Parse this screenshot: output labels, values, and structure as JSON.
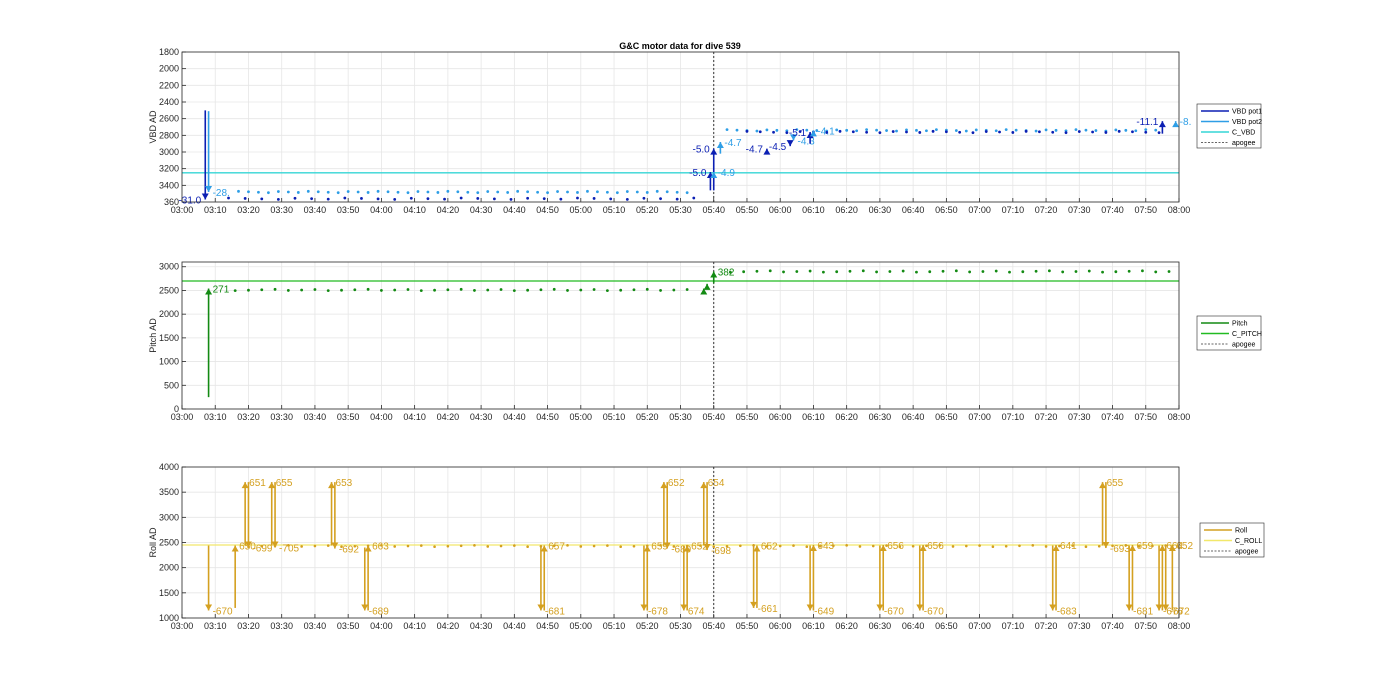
{
  "title": "G&C motor data for dive 539",
  "colors": {
    "vbd_pot1": "#0b1fb3",
    "vbd_pot2": "#2e9ee6",
    "c_vbd": "#35d6d6",
    "pitch": "#138a13",
    "c_pitch": "#22bb22",
    "roll": "#d4a020",
    "c_roll": "#f2e86a",
    "apogee": "#333333",
    "grid": "#e6e6e6"
  },
  "x_tick_labels": [
    "03:00",
    "03:10",
    "03:20",
    "03:30",
    "03:40",
    "03:50",
    "04:00",
    "04:10",
    "04:20",
    "04:30",
    "04:40",
    "04:50",
    "05:00",
    "05:10",
    "05:20",
    "05:30",
    "05:40",
    "05:50",
    "06:00",
    "06:10",
    "06:20",
    "06:30",
    "06:40",
    "06:50",
    "07:00",
    "07:10",
    "07:20",
    "07:30",
    "07:40",
    "07:50",
    "08:00"
  ],
  "chart_data": [
    {
      "type": "scatter",
      "title": "G&C motor data for dive 539",
      "ylabel": "VBD AD",
      "xlim": [
        "03:00",
        "08:00"
      ],
      "ylim": [
        1800,
        3600
      ],
      "y_reversed": true,
      "yticks": [
        1800,
        2000,
        2200,
        2400,
        2600,
        2800,
        3000,
        3200,
        3400,
        3600
      ],
      "y_tick_labels": [
        "1800",
        "2000",
        "2200",
        "2400",
        "2600",
        "2800",
        "3000",
        "3200",
        "3400",
        "360"
      ],
      "grid": true,
      "legend_position": "right",
      "legend": [
        "VBD pot1",
        "VBD pot2",
        "C_VBD",
        "apogee"
      ],
      "c_vbd": 3250,
      "apogee_x": "05:40",
      "pot1_base": [
        {
          "start": "03:14",
          "end": "05:34",
          "step": 5,
          "y": 3560
        },
        {
          "start": "05:50",
          "end": "07:55",
          "step": 4,
          "y": 2760
        }
      ],
      "pot2_base": [
        {
          "start": "03:17",
          "end": "05:34",
          "step": 3,
          "y": 3480
        },
        {
          "start": "05:44",
          "end": "07:55",
          "step": 3,
          "y": 2740
        }
      ],
      "moves": [
        {
          "t": "03:07",
          "from": 2500,
          "to": 3570,
          "series": "VBD pot1",
          "label": "-31.0",
          "label_side": "left"
        },
        {
          "t": "03:08",
          "from": 2510,
          "to": 3480,
          "series": "VBD pot2",
          "label": "-28.",
          "label_side": "right"
        },
        {
          "t": "05:39",
          "from": 3460,
          "to": 3240,
          "series": "VBD pot1",
          "label": "-5.0",
          "label_side": "left"
        },
        {
          "t": "05:40",
          "from": 3460,
          "to": 2960,
          "series": "VBD pot1",
          "label": "-5.0",
          "label_side": "left"
        },
        {
          "t": "05:40",
          "from": 3260,
          "to": 3240,
          "series": "VBD pot2",
          "label": "-4.9",
          "label_side": "right"
        },
        {
          "t": "05:42",
          "from": 3020,
          "to": 2880,
          "series": "VBD pot2",
          "label": "-4.7",
          "label_side": "right"
        },
        {
          "t": "05:56",
          "from": 2980,
          "to": 2960,
          "series": "VBD pot1",
          "label": "-4.7",
          "label_side": "left"
        },
        {
          "t": "06:03",
          "from": 2880,
          "to": 2930,
          "series": "VBD pot1",
          "label": "-4.5",
          "label_side": "left"
        },
        {
          "t": "06:04",
          "from": 2840,
          "to": 2860,
          "series": "VBD pot2",
          "label": "-4.3",
          "label_side": "right"
        },
        {
          "t": "06:09",
          "from": 2900,
          "to": 2760,
          "series": "VBD pot1",
          "label": "-5.1",
          "label_side": "left"
        },
        {
          "t": "06:10",
          "from": 2800,
          "to": 2740,
          "series": "VBD pot2",
          "label": "-4.1",
          "label_side": "right"
        },
        {
          "t": "07:55",
          "from": 2780,
          "to": 2630,
          "series": "VBD pot1",
          "label": "-11.1",
          "label_side": "left"
        },
        {
          "t": "07:59",
          "from": 2640,
          "to": 2630,
          "series": "VBD pot2",
          "label": "-8.",
          "label_side": "right"
        }
      ]
    },
    {
      "type": "scatter",
      "ylabel": "Pitch AD",
      "xlim": [
        "03:00",
        "08:00"
      ],
      "ylim": [
        0,
        3100
      ],
      "yticks": [
        0,
        500,
        1000,
        1500,
        2000,
        2500,
        3000
      ],
      "y_tick_labels": [
        "0",
        "500",
        "1000",
        "1500",
        "2000",
        "2500",
        "3000"
      ],
      "grid": true,
      "legend_position": "right",
      "legend": [
        "Pitch",
        "C_PITCH",
        "apogee"
      ],
      "c_pitch": 2700,
      "apogee_x": "05:40",
      "base": [
        {
          "start": "03:16",
          "end": "05:35",
          "step": 4,
          "y": 2510
        },
        {
          "start": "05:45",
          "end": "07:59",
          "step": 4,
          "y": 2900
        }
      ],
      "moves": [
        {
          "t": "03:08",
          "from": 250,
          "to": 2540,
          "label": "271"
        },
        {
          "t": "05:37",
          "from": 2510,
          "to": 2540,
          "label": ""
        },
        {
          "t": "05:38",
          "from": 2550,
          "to": 2640,
          "label": ""
        },
        {
          "t": "05:40",
          "from": 2650,
          "to": 2900,
          "label": "382"
        }
      ]
    },
    {
      "type": "scatter",
      "ylabel": "Roll AD",
      "xlim": [
        "03:00",
        "08:00"
      ],
      "ylim": [
        1000,
        4000
      ],
      "yticks": [
        1000,
        1500,
        2000,
        2500,
        3000,
        3500,
        4000
      ],
      "y_tick_labels": [
        "1000",
        "1500",
        "2000",
        "2500",
        "3000",
        "3500",
        "4000"
      ],
      "grid": true,
      "legend_position": "right",
      "legend": [
        "Roll",
        "C_ROLL",
        "apogee"
      ],
      "c_roll": 2450,
      "apogee_x": "05:40",
      "base": [
        {
          "start": "03:20",
          "end": "07:58",
          "step": 4,
          "y": 2430
        }
      ],
      "moves": [
        {
          "t": "03:08",
          "from": 2440,
          "to": 1150,
          "label": "-670"
        },
        {
          "t": "03:16",
          "from": 1200,
          "to": 2440,
          "label": "650"
        },
        {
          "t": "03:19",
          "from": 2440,
          "to": 3700,
          "label": "651"
        },
        {
          "t": "03:20",
          "from": 3700,
          "to": 2400,
          "label": "-699"
        },
        {
          "t": "03:27",
          "from": 2440,
          "to": 3700,
          "label": "655"
        },
        {
          "t": "03:28",
          "from": 3700,
          "to": 2400,
          "label": "-705"
        },
        {
          "t": "03:45",
          "from": 2440,
          "to": 3700,
          "label": "653"
        },
        {
          "t": "03:46",
          "from": 3700,
          "to": 2380,
          "label": "-692"
        },
        {
          "t": "03:55",
          "from": 2400,
          "to": 1150,
          "label": "-689"
        },
        {
          "t": "03:56",
          "from": 1150,
          "to": 2440,
          "label": "663"
        },
        {
          "t": "04:48",
          "from": 2440,
          "to": 1150,
          "label": "-681"
        },
        {
          "t": "04:49",
          "from": 1150,
          "to": 2440,
          "label": "657"
        },
        {
          "t": "05:19",
          "from": 2440,
          "to": 1150,
          "label": "-678"
        },
        {
          "t": "05:20",
          "from": 1150,
          "to": 2440,
          "label": "659"
        },
        {
          "t": "05:25",
          "from": 2440,
          "to": 3700,
          "label": "652"
        },
        {
          "t": "05:26",
          "from": 3700,
          "to": 2380,
          "label": "-689"
        },
        {
          "t": "05:31",
          "from": 2440,
          "to": 1150,
          "label": "674"
        },
        {
          "t": "05:32",
          "from": 1150,
          "to": 2440,
          "label": "652"
        },
        {
          "t": "05:37",
          "from": 2440,
          "to": 3700,
          "label": "654"
        },
        {
          "t": "05:38",
          "from": 3700,
          "to": 2350,
          "label": "-698"
        },
        {
          "t": "05:52",
          "from": 2440,
          "to": 1200,
          "label": "-661"
        },
        {
          "t": "05:53",
          "from": 1200,
          "to": 2440,
          "label": "652"
        },
        {
          "t": "06:09",
          "from": 2440,
          "to": 1150,
          "label": "-649"
        },
        {
          "t": "06:10",
          "from": 1150,
          "to": 2450,
          "label": "643"
        },
        {
          "t": "06:30",
          "from": 2440,
          "to": 1150,
          "label": "-670"
        },
        {
          "t": "06:31",
          "from": 1150,
          "to": 2450,
          "label": "656"
        },
        {
          "t": "06:42",
          "from": 2440,
          "to": 1150,
          "label": "-670"
        },
        {
          "t": "06:43",
          "from": 1150,
          "to": 2450,
          "label": "656"
        },
        {
          "t": "07:22",
          "from": 2440,
          "to": 1150,
          "label": "-683"
        },
        {
          "t": "07:23",
          "from": 1150,
          "to": 2450,
          "label": "641"
        },
        {
          "t": "07:37",
          "from": 2440,
          "to": 3700,
          "label": "655"
        },
        {
          "t": "07:38",
          "from": 3700,
          "to": 2390,
          "label": "-693"
        },
        {
          "t": "07:45",
          "from": 2440,
          "to": 1150,
          "label": "-681"
        },
        {
          "t": "07:46",
          "from": 1150,
          "to": 2450,
          "label": "659"
        },
        {
          "t": "07:54",
          "from": 2440,
          "to": 1150,
          "label": "-676"
        },
        {
          "t": "07:55",
          "from": 1150,
          "to": 2450,
          "label": "664"
        },
        {
          "t": "07:56",
          "from": 2440,
          "to": 1150,
          "label": "-672"
        },
        {
          "t": "07:58",
          "from": 1150,
          "to": 2450,
          "label": "652"
        }
      ]
    }
  ]
}
